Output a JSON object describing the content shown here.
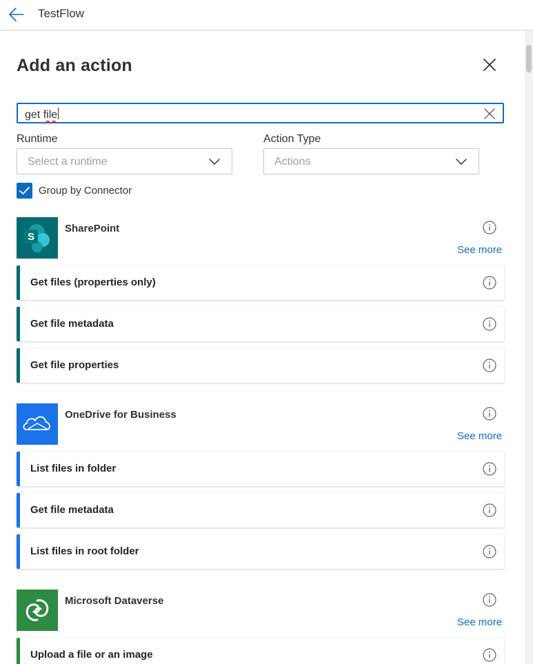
{
  "header": {
    "flow_name": "TestFlow",
    "back_icon": "back-arrow-icon"
  },
  "panel": {
    "title": "Add an action",
    "close_icon": "close-icon",
    "search": {
      "value": "get file",
      "value_prefix": "get ",
      "value_squiggle": "file",
      "clear_icon": "clear-icon"
    },
    "runtime": {
      "label": "Runtime",
      "placeholder": "Select a runtime"
    },
    "action_type": {
      "label": "Action Type",
      "placeholder": "Actions"
    },
    "group_by_connector": {
      "label": "Group by Connector",
      "checked": true
    }
  },
  "connectors": [
    {
      "name": "SharePoint",
      "icon": "sharepoint-icon",
      "color": "#036c70",
      "see_more": "See more",
      "actions": [
        "Get files (properties only)",
        "Get file metadata",
        "Get file properties"
      ]
    },
    {
      "name": "OneDrive for Business",
      "icon": "onedrive-icon",
      "color": "#0f6cbd",
      "accent": "#1a73e8",
      "see_more": "See more",
      "actions": [
        "List files in folder",
        "Get file metadata",
        "List files in root folder"
      ]
    },
    {
      "name": "Microsoft Dataverse",
      "icon": "dataverse-icon",
      "color": "#2e8b42",
      "see_more": "See more",
      "actions": [
        "Upload a file or an image"
      ]
    }
  ]
}
